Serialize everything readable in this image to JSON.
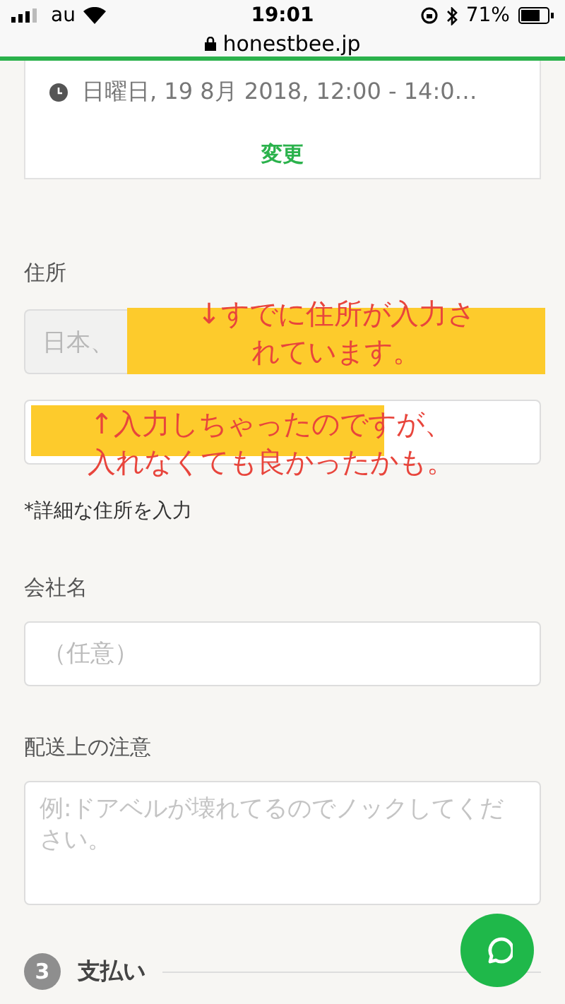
{
  "status_bar": {
    "carrier": "au",
    "time": "19:01",
    "battery": "71%",
    "url": "honestbee.jp"
  },
  "delivery_card": {
    "datetime": "日曜日, 19 8月 2018, 12:00 - 14:0…",
    "change_link": "変更"
  },
  "address": {
    "label": "住所",
    "prefilled_value": "日本、",
    "hint": "*詳細な住所を入力"
  },
  "company": {
    "label": "会社名",
    "placeholder": "（任意）"
  },
  "delivery_note": {
    "label": "配送上の注意",
    "placeholder": "例:ドアベルが壊れてるのでノックしてください。"
  },
  "section": {
    "number": "3",
    "title": "支払い"
  },
  "annotations": [
    {
      "lines": [
        "↓すでに住所が入力さ",
        "れています。"
      ]
    },
    {
      "lines": [
        "↑入力しちゃったのですが、",
        "入れなくても良かったかも。"
      ]
    }
  ]
}
